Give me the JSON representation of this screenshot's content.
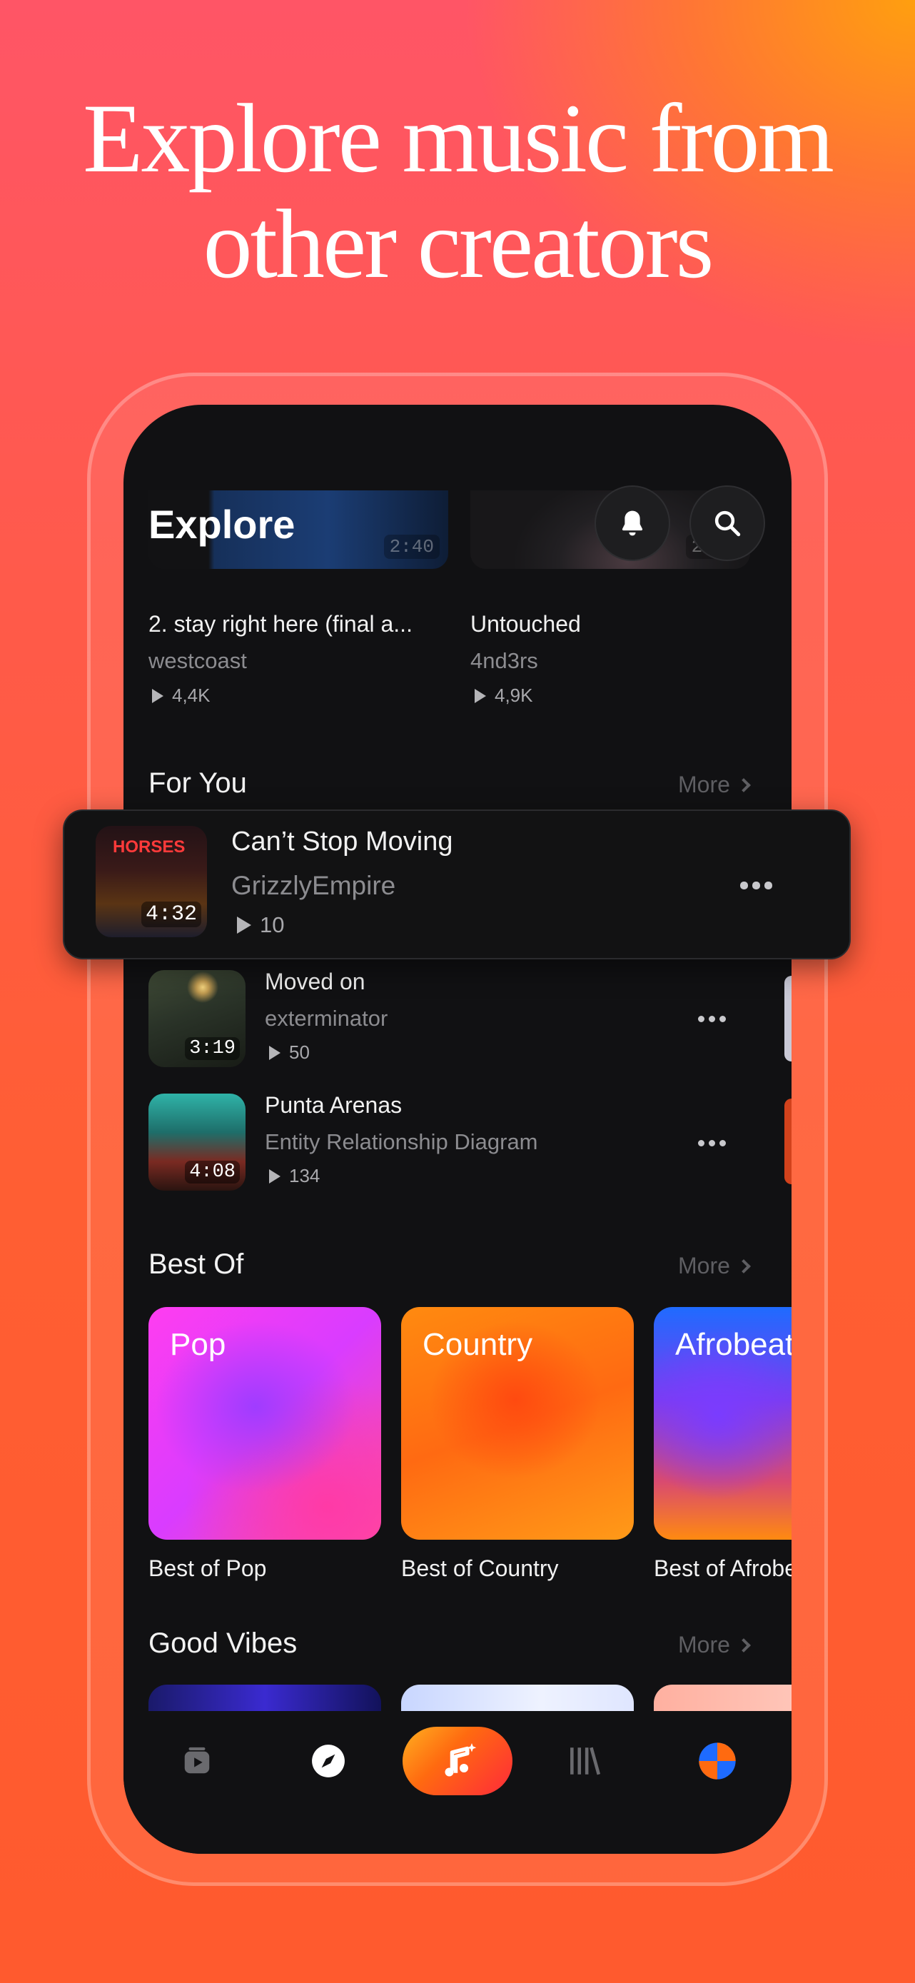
{
  "headline": {
    "line1": "Explore music from",
    "line2": "other creators"
  },
  "header": {
    "title": "Explore"
  },
  "top_songs": [
    {
      "title": "2. stay right here (final a...",
      "artist": "westcoast",
      "plays": "4,4K",
      "duration": "2:40"
    },
    {
      "title": "Untouched",
      "artist": "4nd3rs",
      "plays": "4,9K",
      "duration": "2:30"
    }
  ],
  "for_you": {
    "title": "For You",
    "more": "More",
    "featured": {
      "title": "Can’t Stop Moving",
      "artist": "GrizzlyEmpire",
      "plays": "10",
      "duration": "4:32",
      "thumb_text": "HORSES"
    },
    "items": [
      {
        "title": "Moved on",
        "artist": "exterminator",
        "plays": "50",
        "duration": "3:19"
      },
      {
        "title": "Punta Arenas",
        "artist": "Entity Relationship Diagram",
        "plays": "134",
        "duration": "4:08"
      }
    ]
  },
  "best_of": {
    "title": "Best Of",
    "more": "More",
    "cards": [
      {
        "label": "Pop",
        "caption": "Best of Pop"
      },
      {
        "label": "Country",
        "caption": "Best of Country"
      },
      {
        "label": "Afrobeats",
        "caption": "Best of Afrobeats"
      }
    ]
  },
  "good_vibes": {
    "title": "Good Vibes",
    "more": "More"
  },
  "nav": {
    "items": [
      "feed-icon",
      "compass-icon",
      "create-music-icon",
      "library-icon",
      "profile-avatar"
    ],
    "accent": "#ff7a1a"
  },
  "colors": {
    "background_top": "#ff5566",
    "background_corner": "#ff9f0f",
    "phone_bg": "#111113"
  }
}
